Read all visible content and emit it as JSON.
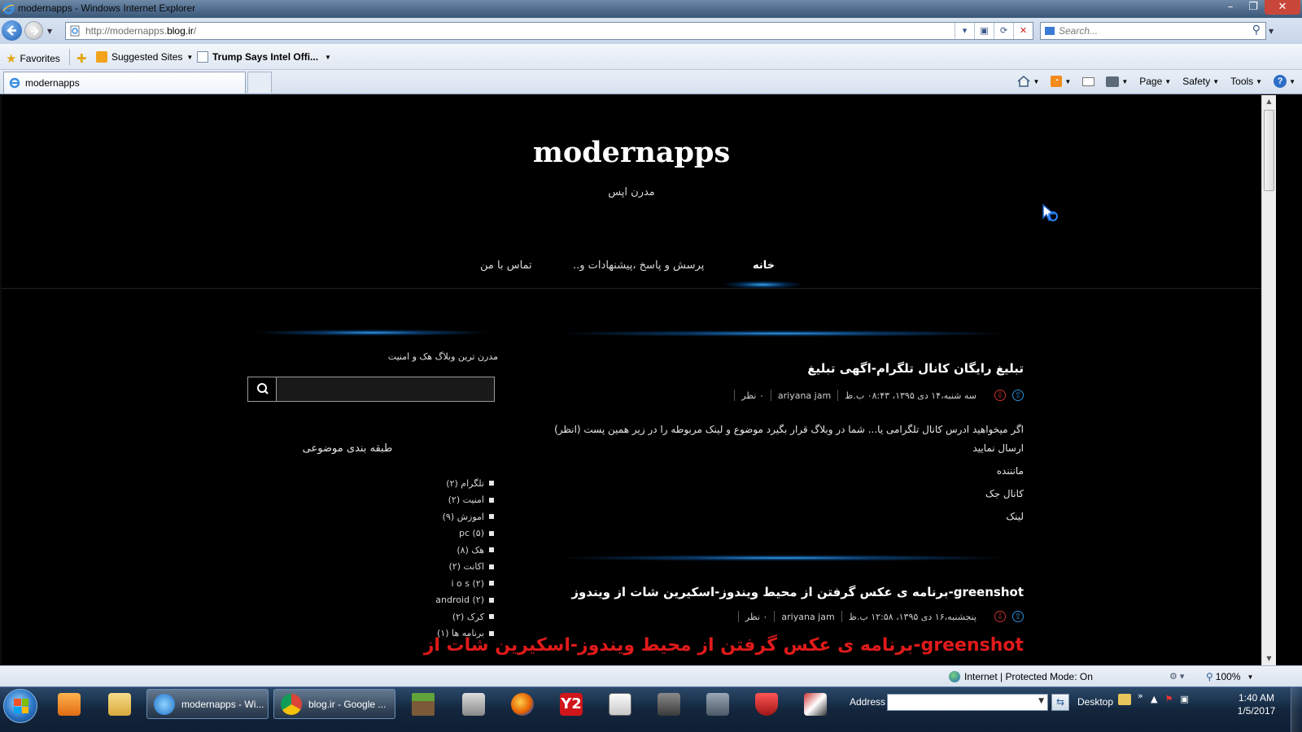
{
  "window": {
    "title": "modernapps - Windows Internet Explorer",
    "buttons": {
      "minimize": "–",
      "maximize": "❐",
      "close": "✕"
    }
  },
  "address_bar": {
    "url_prefix": "http://modernapps.",
    "url_host": "blog.ir",
    "url_suffix": "/",
    "search_placeholder": "Search..."
  },
  "favorites_bar": {
    "favorites_label": "Favorites",
    "suggested_sites": "Suggested Sites",
    "news_item": "Trump Says Intel Offi..."
  },
  "tabs": [
    {
      "label": "modernapps"
    }
  ],
  "command_bar": {
    "page": "Page",
    "safety": "Safety",
    "tools": "Tools"
  },
  "site": {
    "title": "modernapps",
    "subtitle": "مدرن اپس",
    "nav": [
      {
        "label": "خانه",
        "active": true
      },
      {
        "label": "پرسش و پاسخ ،پیشنهادات و..",
        "active": false
      },
      {
        "label": "تماس با من",
        "active": false
      }
    ]
  },
  "posts": [
    {
      "title": "تبلیغ رایگان کانال تلگرام-اگهی تبلیغ",
      "date": "سه شنبه،۱۴ دی ۱۳۹۵، ۰۸:۴۳ ب.ظ",
      "author": "ariyana jam",
      "comments": "۰ نظر",
      "body": [
        "اگر میخواهید ادرس کانال تلگرامی یا... شما در  وبلاگ قرار بگیرد موضوع و لینک  مربوطه را در زیر همین پست (انظر) ارسال نمایید",
        "مانننده",
        "کانال جک",
        "لینک"
      ]
    },
    {
      "title": "greenshot-برنامه ی عکس گرفتن از محیط ویندوز-اسکیرین شات از ویندوز",
      "date": "پنجشنبه،۱۶ دی ۱۳۹۵، ۱۲:۵۸ ب.ظ",
      "author": "ariyana jam",
      "comments": "۰ نظر",
      "headline": "greenshot-برنامه ی عکس گرفتن از محیط ویندوز-اسکیرین شات از"
    }
  ],
  "sidebar": {
    "tagline": "مدرن ترین وبلاگ هک و امنیت",
    "search_placeholder": "",
    "categories_title": "طبقه بندی موضوعی",
    "categories": [
      "تلگرام (۲)",
      "امنیت (۲)",
      "اموزش (۹)",
      "pc (۵)",
      "هک (۸)",
      "اکانت (۲)",
      "i o s (۲)",
      "android (۲)",
      "کرک (۲)",
      "برنامه ها (۱)"
    ]
  },
  "status_bar": {
    "zone": "Internet | Protected Mode: On",
    "zoom": "100%"
  },
  "taskbar": {
    "tasks": [
      {
        "label": "modernapps - Wi..."
      },
      {
        "label": "blog.ir - Google ..."
      }
    ],
    "address_label": "Address",
    "desktop_label": "Desktop",
    "time": "1:40 AM",
    "date": "1/5/2017"
  },
  "colors": {
    "page_bg": "#000000",
    "glow": "#37aaff",
    "headline_red": "#e11a1a"
  }
}
